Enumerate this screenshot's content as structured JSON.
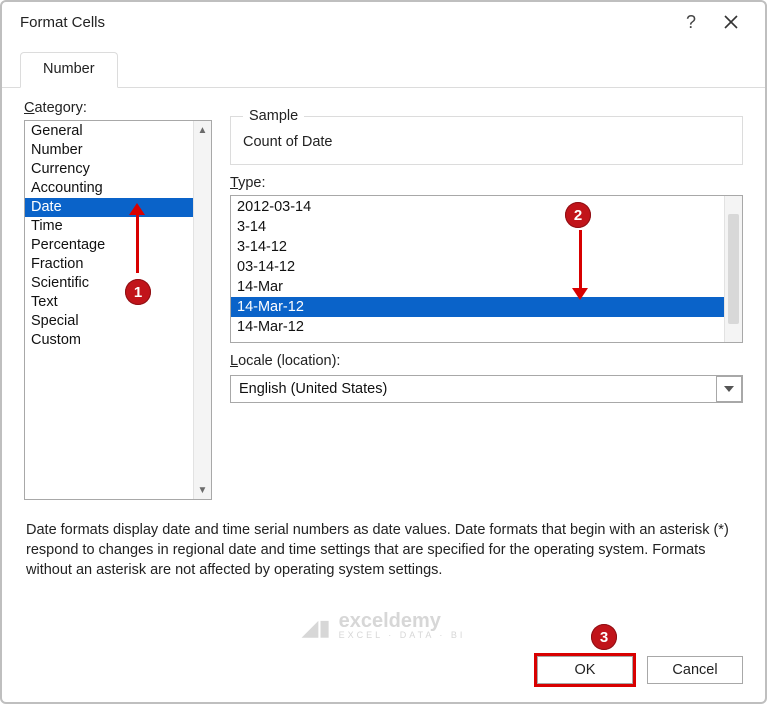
{
  "window": {
    "title": "Format Cells"
  },
  "tabs": {
    "active": "Number"
  },
  "category": {
    "label": "Category:",
    "items": [
      "General",
      "Number",
      "Currency",
      "Accounting",
      "Date",
      "Time",
      "Percentage",
      "Fraction",
      "Scientific",
      "Text",
      "Special",
      "Custom"
    ],
    "selected": "Date"
  },
  "sample": {
    "legend": "Sample",
    "value": "Count of Date"
  },
  "type": {
    "label": "Type:",
    "items": [
      "2012-03-14",
      "3-14",
      "3-14-12",
      "03-14-12",
      "14-Mar",
      "14-Mar-12",
      "14-Mar-12"
    ],
    "selected_index": 5
  },
  "locale": {
    "label": "Locale (location):",
    "value": "English (United States)"
  },
  "description": "Date formats display date and time serial numbers as date values.  Date formats that begin with an asterisk (*) respond to changes in regional date and time settings that are specified for the operating system. Formats without an asterisk are not affected by operating system settings.",
  "buttons": {
    "ok": "OK",
    "cancel": "Cancel"
  },
  "annotations": {
    "m1": "1",
    "m2": "2",
    "m3": "3"
  },
  "watermark": {
    "name": "exceldemy",
    "sub": "EXCEL · DATA · BI"
  }
}
